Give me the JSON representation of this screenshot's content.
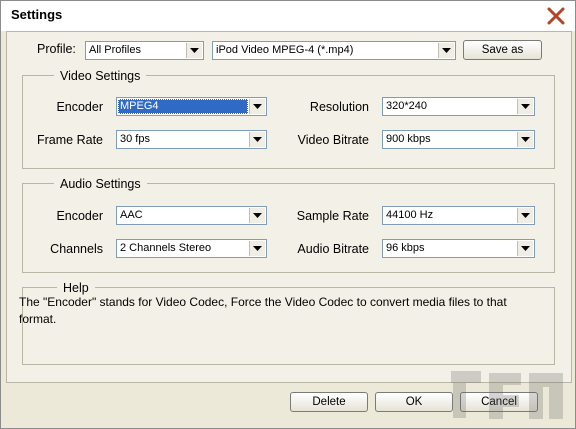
{
  "window": {
    "title": "Settings"
  },
  "profile": {
    "label": "Profile:",
    "category": "All Profiles",
    "format": "iPod Video MPEG-4 (*.mp4)",
    "save_as_label": "Save as"
  },
  "video": {
    "legend": "Video Settings",
    "encoder_label": "Encoder",
    "encoder": "MPEG4",
    "resolution_label": "Resolution",
    "resolution": "320*240",
    "frame_rate_label": "Frame Rate",
    "frame_rate": "30 fps",
    "bitrate_label": "Video Bitrate",
    "bitrate": "900 kbps"
  },
  "audio": {
    "legend": "Audio Settings",
    "encoder_label": "Encoder",
    "encoder": "AAC",
    "sample_rate_label": "Sample Rate",
    "sample_rate": "44100 Hz",
    "channels_label": "Channels",
    "channels": "2 Channels Stereo",
    "bitrate_label": "Audio Bitrate",
    "bitrate": "96 kbps"
  },
  "help": {
    "legend": "Help",
    "text": "The \"Encoder\" stands for Video Codec, Force the Video Codec to convert media files to that format."
  },
  "buttons": {
    "delete_label": "Delete",
    "ok_label": "OK",
    "cancel_label": "Cancel"
  },
  "icons": {
    "close": "close-icon",
    "dropdown": "chevron-down-icon"
  },
  "colors": {
    "close_icon": "#b14525",
    "selection": "#316ac5",
    "dialog_bg": "#ece9d8"
  }
}
